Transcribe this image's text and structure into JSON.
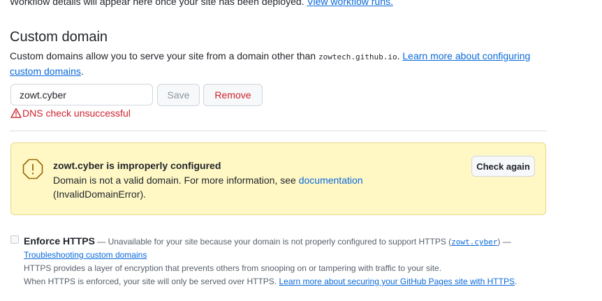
{
  "top_notice": {
    "text": "Workflow details will appear here once your site has been deployed.",
    "link": "View workflow runs."
  },
  "custom_domain": {
    "title": "Custom domain",
    "description_prefix": "Custom domains allow you to serve your site from a domain other than",
    "default_domain": "zowtech.github.io",
    "description_dot": ".",
    "learn_more_link": "Learn more about configuring custom domains",
    "learn_more_tail": ".",
    "input_value": "zowt.cyber",
    "save_label": "Save",
    "remove_label": "Remove",
    "dns_error": "DNS check unsuccessful"
  },
  "warning": {
    "title": "zowt.cyber is improperly configured",
    "message": "Domain is not a valid domain. For more information, see",
    "doc_link": "documentation",
    "error_code": "(InvalidDomainError).",
    "check_again_label": "Check again"
  },
  "https": {
    "checkbox_checked": false,
    "label": "Enforce HTTPS",
    "unavailable_text": "— Unavailable for your site because your domain is not properly configured to support HTTPS (",
    "domain_code": "zowt.cyber",
    "unavailable_tail": ") —",
    "troubleshoot_link": "Troubleshooting custom domains",
    "info_line": "HTTPS provides a layer of encryption that prevents others from snooping on or tampering with traffic to your site.",
    "enforced_line": "When HTTPS is enforced, your site will only be served over HTTPS.",
    "secure_link": "Learn more about securing your GitHub Pages site with HTTPS",
    "secure_tail": "."
  },
  "colors": {
    "link": "#0969da",
    "danger": "#cf222e",
    "warning_bg": "#fff8c5",
    "warning_icon": "#9a6700"
  }
}
